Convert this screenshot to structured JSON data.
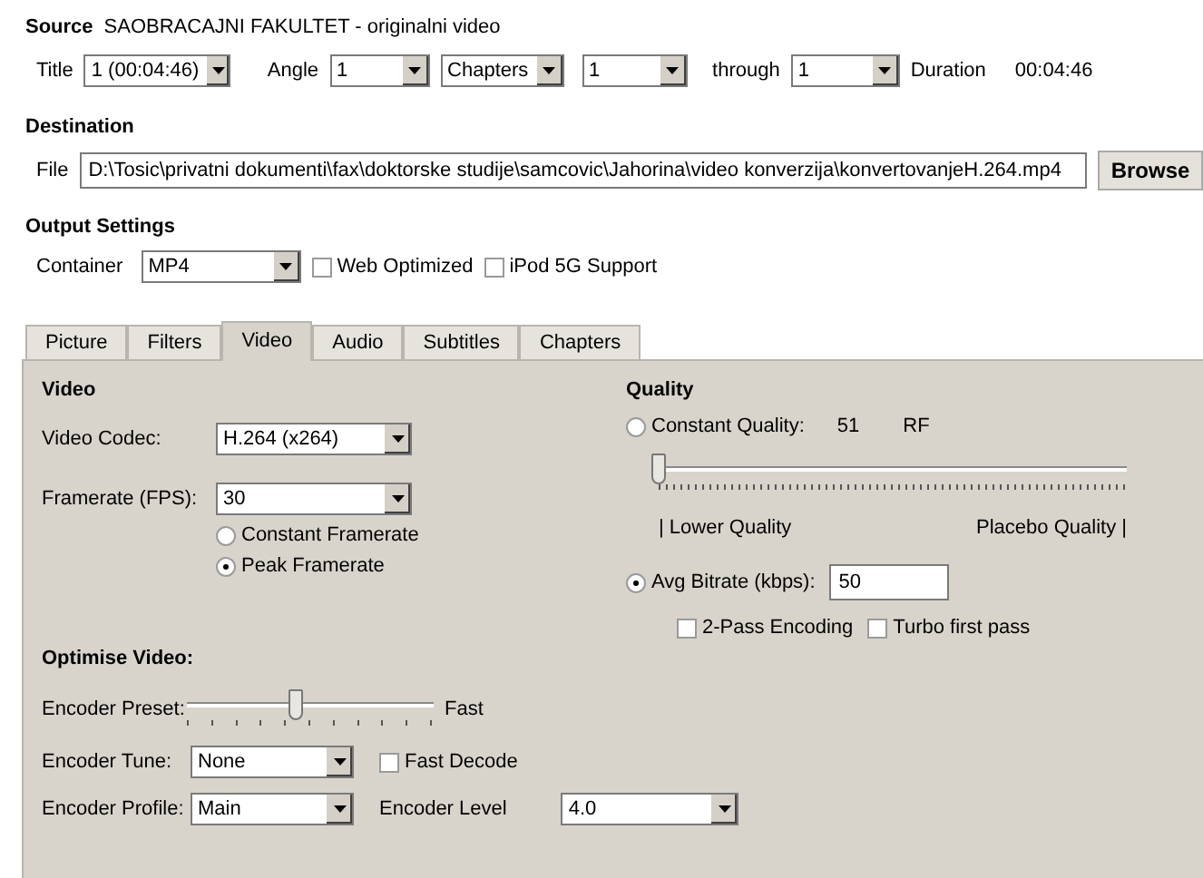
{
  "source": {
    "heading": "Source",
    "name": "SAOBRACAJNI FAKULTET - originalni video",
    "controls": [
      {
        "kind": "label",
        "text": "Title"
      },
      {
        "kind": "combo",
        "value": "1 (00:04:46)"
      },
      {
        "kind": "label",
        "text": "Angle"
      },
      {
        "kind": "combo",
        "value": "1"
      },
      {
        "kind": "combo",
        "value": "Chapters"
      },
      {
        "kind": "combo",
        "value": "1"
      },
      {
        "kind": "label",
        "text": "through"
      },
      {
        "kind": "combo",
        "value": "1"
      },
      {
        "kind": "label",
        "text": "Duration"
      },
      {
        "kind": "label",
        "text": "00:04:46"
      }
    ]
  },
  "destination": {
    "heading": "Destination",
    "controls": [
      {
        "kind": "label",
        "text": "File"
      },
      {
        "kind": "field",
        "value": "D:\\Tosic\\privatni dokumenti\\fax\\doktorske studije\\samcovic\\Jahorina\\video konverzija\\konvertovanjeH.264.mp4"
      },
      {
        "kind": "button",
        "text": "Browse"
      }
    ]
  },
  "output_settings": {
    "heading": "Output Settings",
    "controls": [
      {
        "kind": "label",
        "text": "Container"
      },
      {
        "kind": "combo",
        "value": "MP4"
      },
      {
        "kind": "checkbox",
        "text": "Web Optimized",
        "checked": false
      },
      {
        "kind": "checkbox",
        "text": "iPod 5G Support",
        "checked": false
      }
    ]
  },
  "tabs": [
    {
      "label": "Picture",
      "selected": false
    },
    {
      "label": "Filters",
      "selected": false
    },
    {
      "label": "Video",
      "selected": true
    },
    {
      "label": "Audio",
      "selected": false
    },
    {
      "label": "Subtitles",
      "selected": false
    },
    {
      "label": "Chapters",
      "selected": false
    }
  ],
  "video": {
    "heading": "Video",
    "rows": [
      [
        {
          "kind": "label",
          "text": "Video Codec:"
        },
        {
          "kind": "combo",
          "value": "H.264 (x264)"
        }
      ],
      [
        {
          "kind": "label",
          "text": "Framerate (FPS):"
        },
        {
          "kind": "combo",
          "value": "30"
        }
      ],
      [
        {
          "kind": "radio",
          "text": "Constant Framerate",
          "selected": false
        }
      ],
      [
        {
          "kind": "radio",
          "text": "Peak Framerate",
          "selected": true
        }
      ]
    ]
  },
  "quality": {
    "heading": "Quality",
    "rows": [
      [
        {
          "kind": "radio",
          "text": "Constant Quality:",
          "selected": false
        },
        {
          "kind": "label",
          "text": "51"
        },
        {
          "kind": "unit",
          "text": "RF"
        }
      ],
      [
        {
          "kind": "slider",
          "level": 0
        }
      ],
      [
        {
          "kind": "label",
          "text": "| Lower Quality"
        },
        {
          "kind": "label",
          "text": "Placebo Quality |"
        }
      ],
      [
        {
          "kind": "radio",
          "text": "Avg Bitrate (kbps):",
          "selected": true
        },
        {
          "kind": "field",
          "value": "50"
        }
      ],
      [
        {
          "kind": "checkbox",
          "text": "2-Pass Encoding",
          "checked": false
        },
        {
          "kind": "checkbox",
          "text": "Turbo first pass",
          "checked": false
        }
      ]
    ]
  },
  "optimise": {
    "heading": "Optimise Video:",
    "rows": [
      [
        {
          "kind": "label",
          "text": "Encoder Preset:"
        },
        {
          "kind": "slider",
          "level": 0.44
        },
        {
          "kind": "label",
          "text": "Fast"
        }
      ],
      [
        {
          "kind": "label",
          "text": "Encoder Tune:"
        },
        {
          "kind": "combo",
          "value": "None"
        },
        {
          "kind": "checkbox",
          "text": "Fast Decode",
          "checked": false
        }
      ],
      [
        {
          "kind": "label",
          "text": "Encoder Profile:"
        },
        {
          "kind": "combo",
          "value": "Main"
        },
        {
          "kind": "label",
          "text": "Encoder Level"
        },
        {
          "kind": "combo",
          "value": "4.0"
        }
      ]
    ]
  }
}
